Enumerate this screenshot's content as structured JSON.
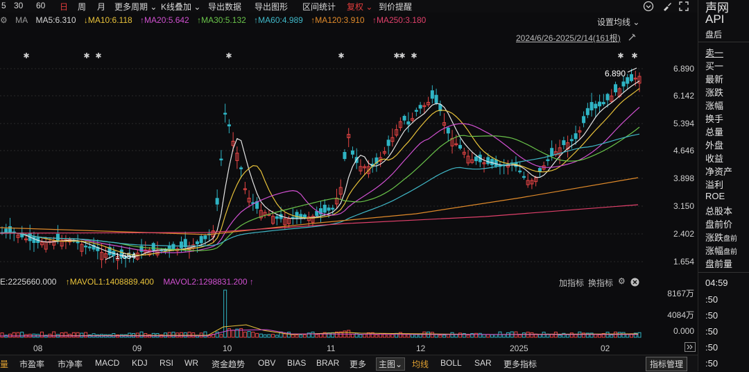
{
  "toolbar": {
    "items": [
      "5",
      "30",
      "60",
      "日",
      "周",
      "月",
      "更多周期 ⌄",
      "K线叠加 ⌄",
      "导出数据",
      "导出图形",
      "区间统计",
      "复权 ⌄",
      "到价提醒"
    ],
    "active_index": 3
  },
  "window_icons": [
    "circle-chevron-icon",
    "brush-icon",
    "fullscreen-icon"
  ],
  "ma_legend": {
    "prefix": "MA",
    "items": [
      {
        "label": "MA5:6.310",
        "color": "#d8d8d8"
      },
      {
        "label": "↓MA10:6.118",
        "color": "#e8c23a"
      },
      {
        "label": "↑MA20:5.642",
        "color": "#d050d0"
      },
      {
        "label": "↑MA30:5.132",
        "color": "#6ac44a"
      },
      {
        "label": "↑MA60:4.989",
        "color": "#40b8c8"
      },
      {
        "label": "↑MA120:3.910",
        "color": "#e08a2a"
      },
      {
        "label": "↑MA250:3.180",
        "color": "#e0406a"
      }
    ],
    "settings_label": "设置均线 ⌄"
  },
  "range_label": "2024/6/26-2025/2/14(161根)",
  "price_axis": [
    "6.890",
    "6.142",
    "5.394",
    "4.646",
    "3.898",
    "3.150",
    "2.402",
    "1.654"
  ],
  "annotations": {
    "high": "6.890",
    "low": "1.654"
  },
  "volume_legend": {
    "items": [
      {
        "label": "E:2225660.000",
        "color": "#d8d8d8"
      },
      {
        "label": "↑MAVOL1:1408889.400",
        "color": "#e8c23a"
      },
      {
        "label": "MAVOL2:1298831.200 ↑",
        "color": "#d050d0"
      }
    ],
    "add_indicator": "加指标",
    "switch_indicator": "换指标"
  },
  "volume_axis": [
    "8167万",
    "4084万",
    "0.000"
  ],
  "date_axis": [
    "08",
    "09",
    "10",
    "11",
    "12",
    "2025",
    "02"
  ],
  "bottom_bar": {
    "items": [
      "量",
      "市盈率",
      "市净率",
      "MACD",
      "KDJ",
      "RSI",
      "WR",
      "资金趋势",
      "OBV",
      "BIAS",
      "BRAR",
      "更多",
      "主图⌄",
      "均线",
      "BOLL",
      "SAR",
      "更多指标"
    ],
    "manage": "指标管理"
  },
  "right_pane": {
    "header": [
      "声网",
      "API",
      "盘后"
    ],
    "fields": [
      "卖一",
      "买一",
      "最新",
      "涨跌",
      "涨幅",
      "换手",
      "总量",
      "外盘",
      "收益",
      "净资产",
      "溢利",
      "ROE",
      "总股本",
      "盘前价"
    ],
    "premarket": [
      [
        "涨跌",
        "盘前"
      ],
      [
        "涨幅",
        "盘前"
      ]
    ],
    "premarket_vol": "盘前量",
    "times": [
      "04:59",
      ":50",
      ":50",
      ":50",
      ":50",
      ":50"
    ]
  }
}
